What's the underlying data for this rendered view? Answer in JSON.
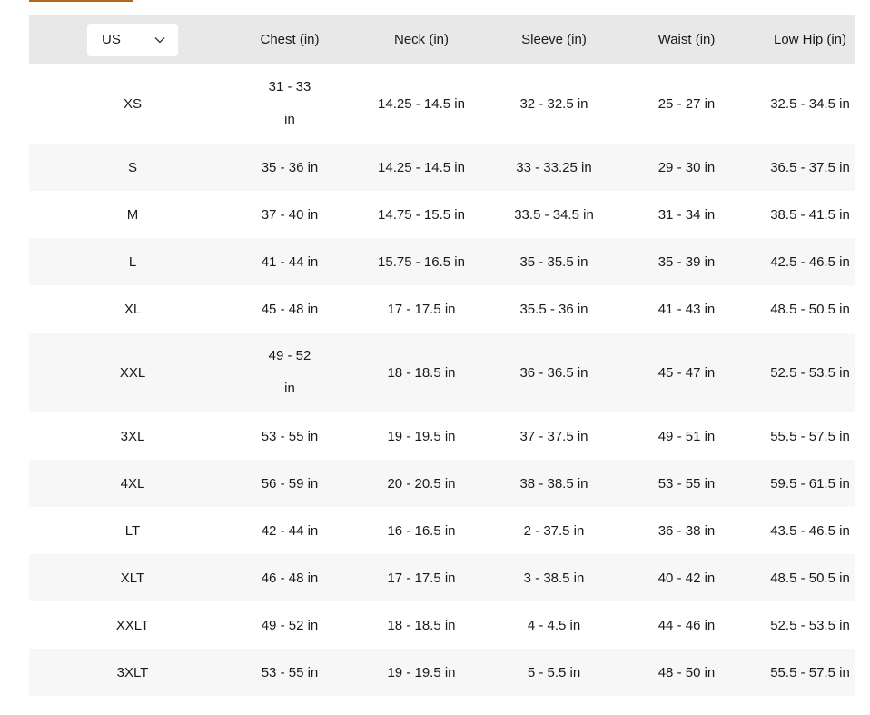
{
  "unit_selector": {
    "value": "US",
    "icon": "chevron-down-icon"
  },
  "columns": [
    "Chest (in)",
    "Neck (in)",
    "Sleeve (in)",
    "Waist (in)",
    "Low Hip (in)"
  ],
  "rows": [
    {
      "size": "XS",
      "chest": "31 - 33 in",
      "neck": "14.25 - 14.5 in",
      "sleeve": "32 - 32.5 in",
      "waist": "25 - 27 in",
      "low_hip": "32.5 - 34.5 in"
    },
    {
      "size": "S",
      "chest": "35 - 36 in",
      "neck": "14.25 - 14.5 in",
      "sleeve": "33 - 33.25 in",
      "waist": "29 - 30 in",
      "low_hip": "36.5 - 37.5 in"
    },
    {
      "size": "M",
      "chest": "37 - 40 in",
      "neck": "14.75 - 15.5 in",
      "sleeve": "33.5 - 34.5 in",
      "waist": "31 - 34 in",
      "low_hip": "38.5 - 41.5 in"
    },
    {
      "size": "L",
      "chest": "41 - 44 in",
      "neck": "15.75 - 16.5 in",
      "sleeve": "35 - 35.5 in",
      "waist": "35 - 39 in",
      "low_hip": "42.5 - 46.5 in"
    },
    {
      "size": "XL",
      "chest": "45 - 48 in",
      "neck": "17 - 17.5 in",
      "sleeve": "35.5 - 36 in",
      "waist": "41 - 43 in",
      "low_hip": "48.5 - 50.5 in"
    },
    {
      "size": "XXL",
      "chest": "49 - 52 in",
      "neck": "18 - 18.5 in",
      "sleeve": "36 - 36.5 in",
      "waist": "45 - 47 in",
      "low_hip": "52.5 - 53.5 in"
    },
    {
      "size": "3XL",
      "chest": "53 - 55 in",
      "neck": "19 - 19.5 in",
      "sleeve": "37 - 37.5 in",
      "waist": "49 - 51 in",
      "low_hip": "55.5 - 57.5 in"
    },
    {
      "size": "4XL",
      "chest": "56 - 59 in",
      "neck": "20 - 20.5 in",
      "sleeve": "38 - 38.5 in",
      "waist": "53 - 55 in",
      "low_hip": "59.5 - 61.5 in"
    },
    {
      "size": "LT",
      "chest": "42 - 44 in",
      "neck": "16 - 16.5 in",
      "sleeve": "2 - 37.5 in",
      "waist": "36 - 38 in",
      "low_hip": "43.5 - 46.5 in"
    },
    {
      "size": "XLT",
      "chest": "46 - 48 in",
      "neck": "17 - 17.5 in",
      "sleeve": "3 - 38.5 in",
      "waist": "40 - 42 in",
      "low_hip": "48.5 - 50.5 in"
    },
    {
      "size": "XXLT",
      "chest": "49 - 52 in",
      "neck": "18 - 18.5 in",
      "sleeve": "4 - 4.5 in",
      "waist": "44 - 46 in",
      "low_hip": "52.5 - 53.5 in"
    },
    {
      "size": "3XLT",
      "chest": "53 - 55 in",
      "neck": "19 - 19.5 in",
      "sleeve": "5 - 5.5 in",
      "waist": "48 - 50 in",
      "low_hip": "55.5 - 57.5 in"
    }
  ],
  "colors": {
    "header_bg": "#e8e8e8",
    "alt_row_bg": "#f7f7f7",
    "accent": "#b5651d"
  }
}
